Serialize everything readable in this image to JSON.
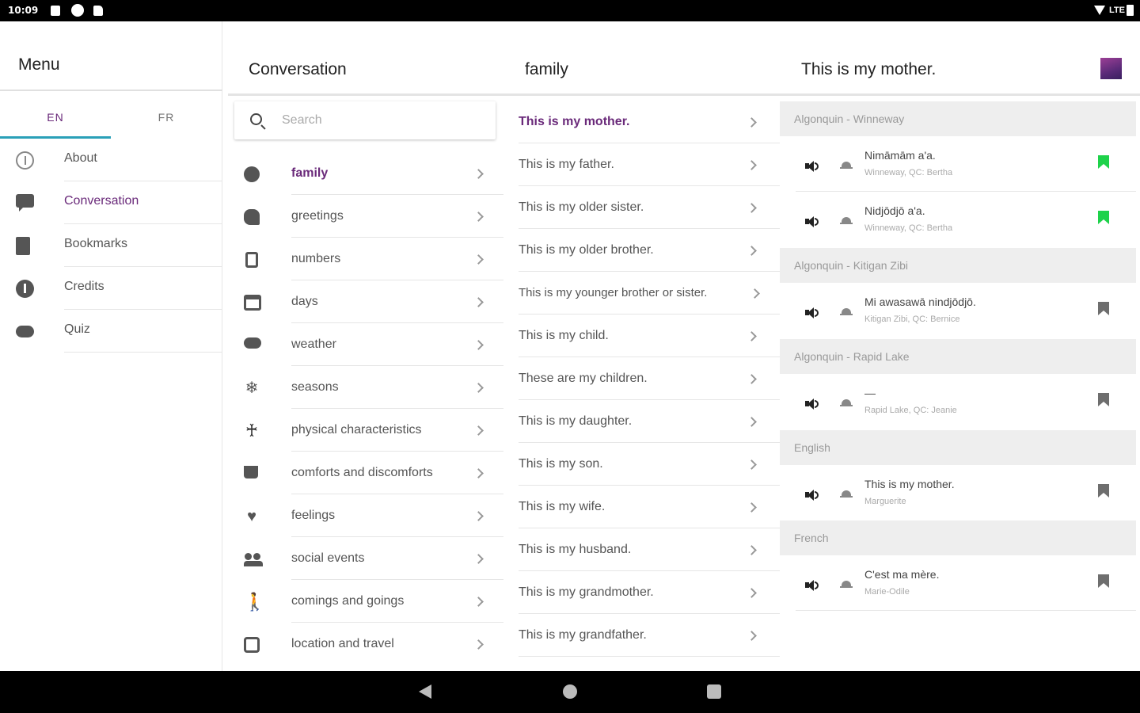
{
  "status_bar": {
    "time": "10:09",
    "network": "LTE"
  },
  "menu": {
    "title": "Menu",
    "languages": [
      {
        "label": "EN",
        "active": true
      },
      {
        "label": "FR",
        "active": false
      }
    ],
    "items": [
      {
        "label": "About",
        "icon": "info-outline-icon",
        "active": false
      },
      {
        "label": "Conversation",
        "icon": "chat-icon",
        "active": true
      },
      {
        "label": "Bookmarks",
        "icon": "bookmarks-icon",
        "active": false
      },
      {
        "label": "Credits",
        "icon": "info-icon",
        "active": false
      },
      {
        "label": "Quiz",
        "icon": "gamepad-icon",
        "active": false
      }
    ]
  },
  "conversation": {
    "title": "Conversation",
    "search_placeholder": "Search",
    "categories": [
      {
        "label": "family",
        "icon": "person-icon",
        "active": true
      },
      {
        "label": "greetings",
        "icon": "chat-bubbles-icon"
      },
      {
        "label": "numbers",
        "icon": "calculator-icon"
      },
      {
        "label": "days",
        "icon": "calendar-icon"
      },
      {
        "label": "weather",
        "icon": "cloud-rain-icon"
      },
      {
        "label": "seasons",
        "icon": "snowflake-icon"
      },
      {
        "label": "physical characteristics",
        "icon": "accessibility-icon"
      },
      {
        "label": "comforts and discomforts",
        "icon": "coffee-icon"
      },
      {
        "label": "feelings",
        "icon": "heart-icon"
      },
      {
        "label": "social events",
        "icon": "people-icon"
      },
      {
        "label": "comings and goings",
        "icon": "walking-icon"
      },
      {
        "label": "location and travel",
        "icon": "bus-icon"
      }
    ]
  },
  "family": {
    "title": "family",
    "phrases": [
      {
        "label": "This is my mother.",
        "active": true
      },
      {
        "label": "This is my father."
      },
      {
        "label": "This is my older sister."
      },
      {
        "label": "This is my older brother."
      },
      {
        "label": "This is my younger brother or sister."
      },
      {
        "label": "This is my child."
      },
      {
        "label": "These are my children."
      },
      {
        "label": "This is my daughter."
      },
      {
        "label": "This is my son."
      },
      {
        "label": "This is my wife."
      },
      {
        "label": "This is my husband."
      },
      {
        "label": "This is my grandmother."
      },
      {
        "label": "This is my grandfather."
      }
    ]
  },
  "detail": {
    "title": "This is my mother.",
    "groups": [
      {
        "header": "Algonquin - Winneway",
        "entries": [
          {
            "text": "Nimāmām a'a.",
            "source": "Winneway, QC: Bertha",
            "bookmarked": true
          },
          {
            "text": "Nidjōdjō a'a.",
            "source": "Winneway, QC: Bertha",
            "bookmarked": true
          }
        ]
      },
      {
        "header": "Algonquin - Kitigan Zibi",
        "entries": [
          {
            "text": "Mi awasawā nindjōdjō.",
            "source": "Kitigan Zibi, QC: Bernice",
            "bookmarked": false
          }
        ]
      },
      {
        "header": "Algonquin - Rapid Lake",
        "entries": [
          {
            "text": "—",
            "source": "Rapid Lake, QC: Jeanie",
            "bookmarked": false
          }
        ]
      },
      {
        "header": "English",
        "entries": [
          {
            "text": "This is my mother.",
            "source": "Marguerite",
            "bookmarked": false
          }
        ]
      },
      {
        "header": "French",
        "entries": [
          {
            "text": "C'est ma mère.",
            "source": "Marie-Odile",
            "bookmarked": false
          }
        ]
      }
    ]
  },
  "colors": {
    "accent": "#6a2a7a",
    "tab_indicator": "#2aa0b8",
    "bookmark_active": "#1ed24a",
    "bookmark_inactive": "#6e6e6e"
  }
}
